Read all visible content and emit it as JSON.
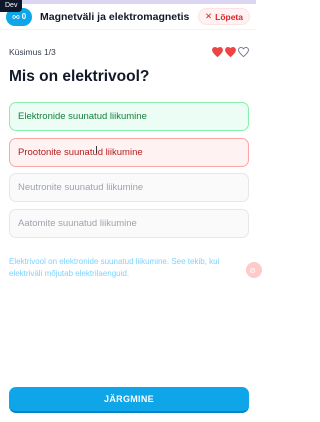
{
  "dev_badge": "Dev",
  "header": {
    "streak_count": "0",
    "title": "Magnetväli ja elektromagnetism",
    "quit_label": "Lõpeta"
  },
  "quiz": {
    "counter": "Küsimus 1/3",
    "hearts": {
      "filled": 2,
      "total": 3
    },
    "question": "Mis on elektrivool?",
    "answers": [
      {
        "label": "Elektronide suunatud liikumine",
        "state": "correct"
      },
      {
        "label": "Prootonite suunatud liikumine",
        "state": "wrong"
      },
      {
        "label": "Neutronite suunatud liikumine",
        "state": "neutral"
      },
      {
        "label": "Aatomite suunatud liikumine",
        "state": "neutral"
      }
    ],
    "explanation": "Elektrivool on elektronide suunatud liikumine. See tekib, kui elektriväli mõjutab elektrilaenguid.",
    "next_label": "JÄRGMINE"
  },
  "colors": {
    "accent": "#0ea5e9",
    "correct": "#15803d",
    "wrong": "#b91c1c",
    "heart": "#ef4444"
  },
  "icons": {
    "streak": "infinity-icon",
    "quit": "close-icon",
    "heart": "heart-icon"
  }
}
